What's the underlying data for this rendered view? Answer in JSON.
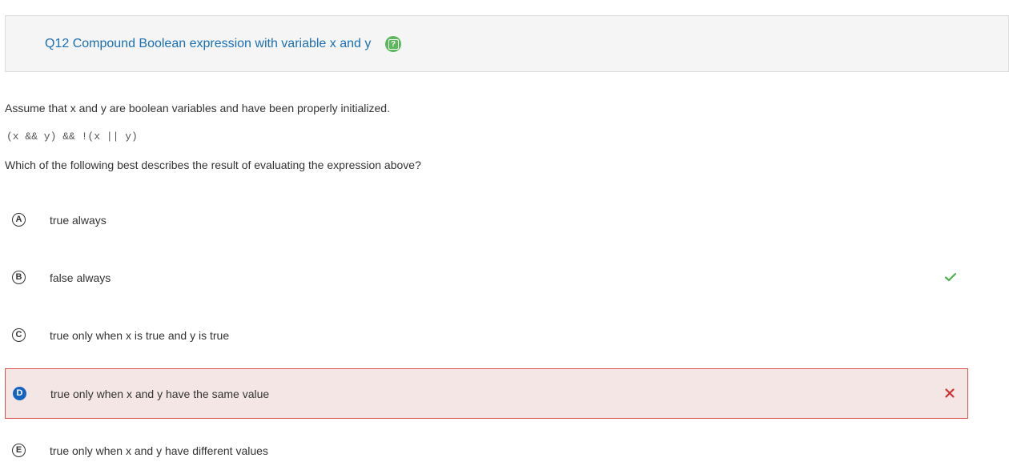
{
  "question": {
    "title": "Q12 Compound Boolean expression with variable x and y",
    "help_icon": "question-mark-icon",
    "stem_intro": "Assume that x and y are boolean variables and have been properly initialized.",
    "stem_code": "(x && y) && !(x || y)",
    "stem_prompt": "Which of the following best describes the result of evaluating the expression above?"
  },
  "choices": [
    {
      "letter": "A",
      "text": "true always",
      "state": "none"
    },
    {
      "letter": "B",
      "text": "false always",
      "state": "correct"
    },
    {
      "letter": "C",
      "text": "true only when x is true and y is true",
      "state": "none"
    },
    {
      "letter": "D",
      "text": "true only when x and y have the same value",
      "state": "selected-wrong"
    },
    {
      "letter": "E",
      "text": "true only when x and y have different values",
      "state": "none"
    }
  ],
  "colors": {
    "title": "#1a6fb5",
    "help_icon": "#5cb85c",
    "correct_check": "#4caf50",
    "wrong_x": "#d32f2f",
    "selected_bg": "#f5e6e6",
    "selected_border": "#d9534f",
    "selected_letter_bg": "#1565c0"
  }
}
